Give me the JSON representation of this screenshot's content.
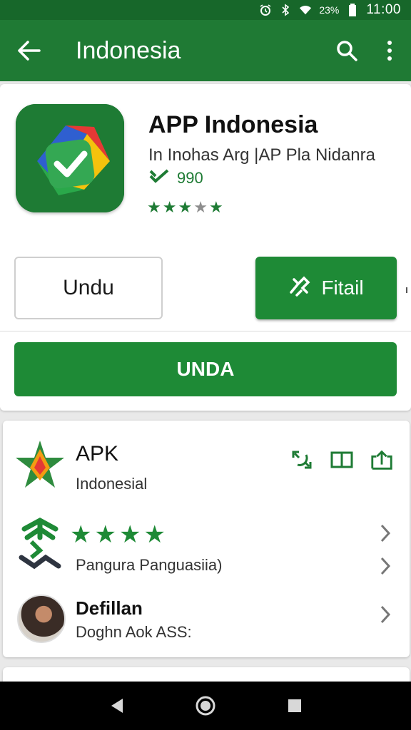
{
  "status_bar": {
    "battery_text": "23%",
    "time": "11:00"
  },
  "app_bar": {
    "title": "Indonesia"
  },
  "app": {
    "name": "APP Indonesia",
    "developer": "In Inohas Arg |AP Pla Nidanra",
    "count": "990",
    "rating_filled": 3,
    "rating_total": 5
  },
  "buttons": {
    "outline_label": "Undu",
    "green_label": "Fitail",
    "wide_label": "UNDA"
  },
  "rows": [
    {
      "title": "APK",
      "subtitle": "Indonesial"
    },
    {
      "stars_filled": 4,
      "subtitle": "Pangura Panguasiia)"
    },
    {
      "title": "Defillan",
      "subtitle": "Doghn Aok ASS:"
    }
  ],
  "colors": {
    "status_bar": "#17672a",
    "app_bar": "#1f7a34",
    "accent": "#1e8a36"
  },
  "icons": [
    "alarm-icon",
    "bluetooth-icon",
    "wifi-icon",
    "battery-icon",
    "back-arrow-icon",
    "search-icon",
    "more-vert-icon",
    "app-logo-icon",
    "verified-icon",
    "star-icon",
    "tools-icon",
    "apk-star-icon",
    "sync-icon",
    "book-icon",
    "upload-icon",
    "share-icon",
    "chevron-right-icon",
    "nav-back-icon",
    "nav-home-icon",
    "nav-recents-icon"
  ]
}
